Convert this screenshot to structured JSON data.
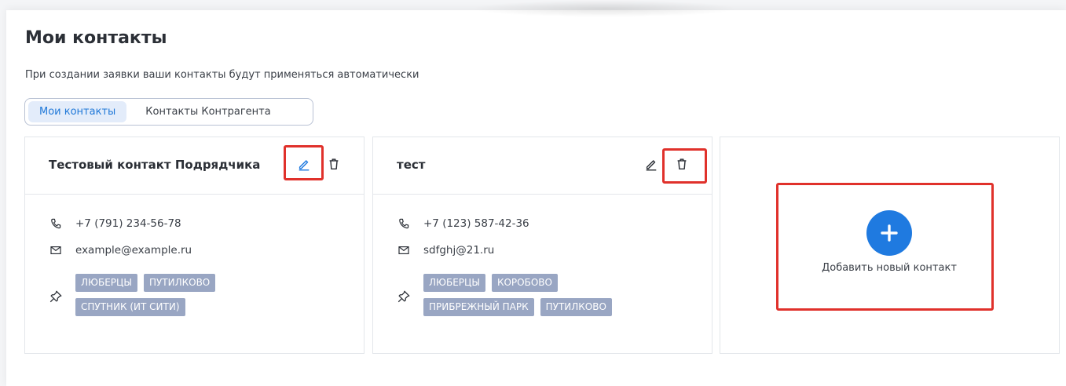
{
  "page": {
    "title": "Мои контакты",
    "subtitle": "При создании заявки ваши контакты будут применяться автоматически"
  },
  "tabs": [
    {
      "label": "Мои контакты",
      "active": true
    },
    {
      "label": "Контакты Контрагента",
      "active": false
    }
  ],
  "contacts": [
    {
      "name": "Тестовый контакт Подрядчика",
      "phone": "+7 (791) 234-56-78",
      "email": "example@example.ru",
      "tags": [
        "ЛЮБЕРЦЫ",
        "ПУТИЛКОВО",
        "СПУТНИК (ИТ СИТИ)"
      ]
    },
    {
      "name": "тест",
      "phone": "+7 (123) 587-42-36",
      "email": "sdfghj@21.ru",
      "tags": [
        "ЛЮБЕРЦЫ",
        "КОРОБОВО",
        "ПРИБРЕЖНЫЙ ПАРК",
        "ПУТИЛКОВО"
      ]
    }
  ],
  "add_contact": {
    "label": "Добавить новый контакт"
  },
  "icons": {
    "edit": "pencil-icon",
    "delete": "trash-icon",
    "phone": "phone-icon",
    "email": "envelope-icon",
    "location": "pin-icon",
    "add": "plus-icon"
  },
  "colors": {
    "accent": "#1f7ae0",
    "tab_active_bg": "#e3ecfa",
    "tag_bg": "#99a6c3",
    "highlight": "#e0312b"
  }
}
